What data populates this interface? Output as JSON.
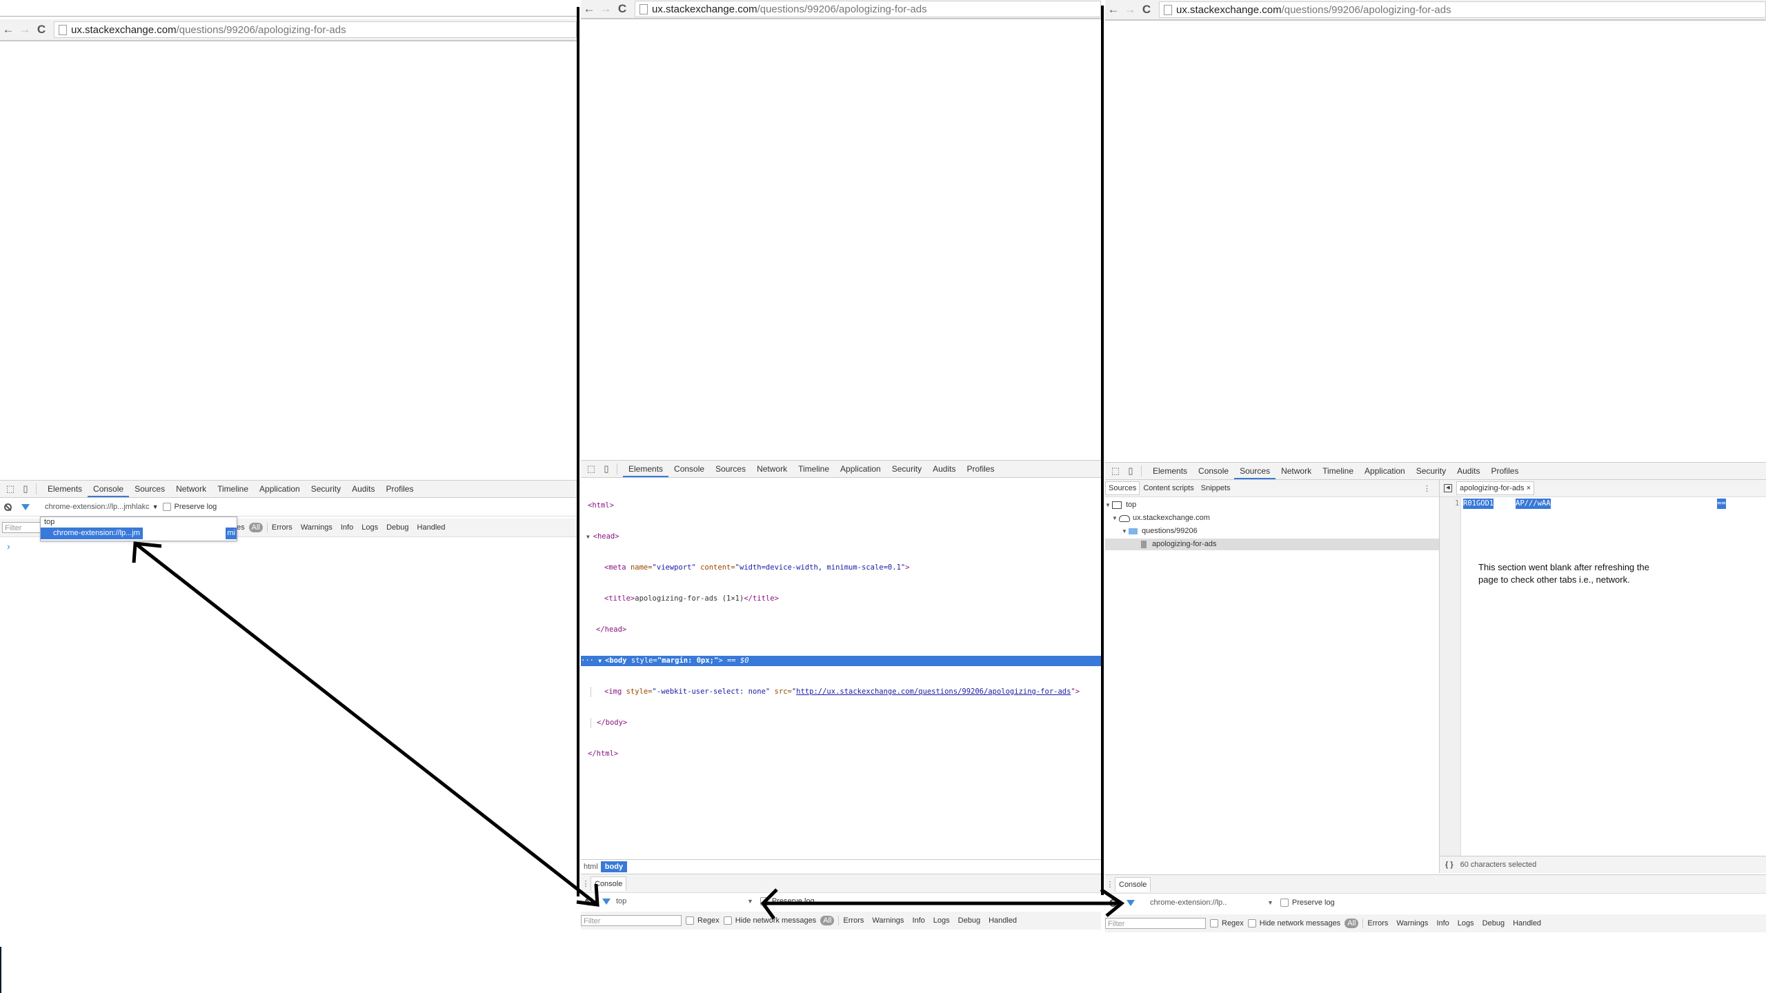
{
  "url": {
    "host": "ux.stackexchange.com",
    "path": "/questions/99206/apologizing-for-ads"
  },
  "nav": {
    "back": "←",
    "forward": "→",
    "reload": "C"
  },
  "devtools_tabs": [
    "Elements",
    "Console",
    "Sources",
    "Network",
    "Timeline",
    "Application",
    "Security",
    "Audits",
    "Profiles"
  ],
  "left": {
    "active_tab": "Console",
    "context_selector": "chrome-extension://lp...jmhlakc",
    "preserve_log": "Preserve log",
    "dropdown": {
      "option_top": "top",
      "option_ext": "chrome-extension://lp...jm",
      "option_ext_tail": "mi"
    },
    "filter_placeholder": "Filter",
    "partial_label": "es",
    "levels": {
      "all": "All",
      "errors": "Errors",
      "warnings": "Warnings",
      "info": "Info",
      "logs": "Logs",
      "debug": "Debug",
      "handled": "Handled"
    },
    "prompt": "›"
  },
  "middle": {
    "active_tab": "Elements",
    "dom_lines": {
      "html_open": "<html>",
      "head_open": "<head>",
      "meta": {
        "tag": "<meta ",
        "name_attr": "name=",
        "name_val": "\"viewport\"",
        "content_attr": " content=",
        "content_val": "\"width=device-width, minimum-scale=0.1\"",
        "close": ">"
      },
      "title": {
        "open": "<title>",
        "text": "apologizing-for-ads (1×1)",
        "close": "</title>"
      },
      "head_close": "</head>",
      "body": {
        "open": "<body ",
        "style_attr": "style=",
        "style_val": "\"margin: 0px;\"",
        "close": ">",
        "suffix": " == $0"
      },
      "img": {
        "open": "<img ",
        "style_attr": "style=",
        "style_val": "\"-webkit-user-select: none\"",
        "src_attr": " src=",
        "src_val": "http://ux.stackexchange.com/questions/99206/apologizing-for-ads",
        "close": "\">"
      },
      "body_close": "</body>",
      "html_close": "</html>"
    },
    "breadcrumbs": [
      "html",
      "body"
    ],
    "drawer_tab": "Console",
    "context_selector": "top",
    "preserve_log": "Preserve log",
    "filter_placeholder": "Filter",
    "regex": "Regex",
    "hide_network": "Hide network messages",
    "levels": {
      "all": "All",
      "errors": "Errors",
      "warnings": "Warnings",
      "info": "Info",
      "logs": "Logs",
      "debug": "Debug",
      "handled": "Handled"
    }
  },
  "right": {
    "active_tab": "Sources",
    "nav_tabs": [
      "Sources",
      "Content scripts",
      "Snippets"
    ],
    "tree": {
      "top": "top",
      "domain": "ux.stackexchange.com",
      "folder": "questions/99206",
      "file": "apologizing-for-ads"
    },
    "editor_tab": "apologizing-for-ads",
    "line_number": "1",
    "code_sel_1": "R01GOD1",
    "code_sel_2": "AP///wAA",
    "code_sel_3": "==",
    "annotation": "This section went blank after refreshing the page to check other tabs i.e., network.",
    "status": "60 characters selected",
    "pretty_print": "{ }",
    "drawer_tab": "Console",
    "context_selector": "chrome-extension://lp..",
    "preserve_log": "Preserve log",
    "filter_placeholder": "Filter",
    "regex": "Regex",
    "hide_network": "Hide network messages",
    "levels": {
      "all": "All",
      "errors": "Errors",
      "warnings": "Warnings",
      "info": "Info",
      "logs": "Logs",
      "debug": "Debug",
      "handled": "Handled"
    }
  },
  "colors": {
    "accent": "#3879d9",
    "selection": "#3879d9",
    "annotation_line": "#000000"
  }
}
